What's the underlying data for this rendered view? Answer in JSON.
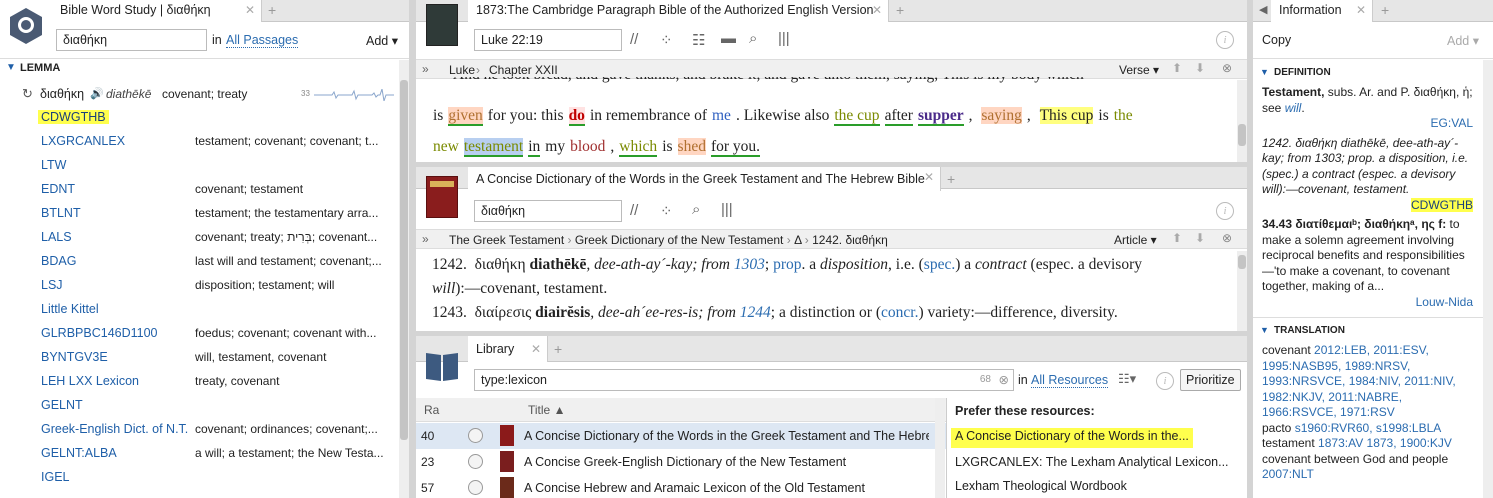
{
  "wordstudy": {
    "tab": "Bible Word Study | διαθήκη",
    "query": "διαθήκη",
    "in_label": "in",
    "passages": "All Passages",
    "add": "Add",
    "section": "LEMMA",
    "lemma_greek": "διαθήκη",
    "lemma_translit": "diathēkē",
    "lemma_gloss": "covenant; treaty",
    "count": "33",
    "rows": [
      {
        "name": "CDWGTHB",
        "gloss": "",
        "hl": true
      },
      {
        "name": "LXGRCANLEX",
        "gloss": "testament; covenant; covenant; t..."
      },
      {
        "name": "LTW",
        "gloss": ""
      },
      {
        "name": "EDNT",
        "gloss": "covenant; testament"
      },
      {
        "name": "BTLNT",
        "gloss": "testament; the testamentary arra..."
      },
      {
        "name": "LALS",
        "gloss": "covenant; treaty; בְּרִית; covenant..."
      },
      {
        "name": "BDAG",
        "gloss": "last will and testament; covenant;..."
      },
      {
        "name": "LSJ",
        "gloss": "disposition; testament; will"
      },
      {
        "name": "Little Kittel",
        "gloss": ""
      },
      {
        "name": "GLRBPBC146D1100",
        "gloss": "foedus; covenant; covenant with..."
      },
      {
        "name": "BYNTGV3E",
        "gloss": "will, testament, covenant"
      },
      {
        "name": "LEH LXX Lexicon",
        "gloss": "treaty, covenant"
      },
      {
        "name": "GELNT",
        "gloss": ""
      },
      {
        "name": "Greek-English Dict. of N.T.",
        "gloss": "covenant; ordinances; covenant;..."
      },
      {
        "name": "GELNT:ALBA",
        "gloss": "a will; a testament; the New Testa..."
      },
      {
        "name": "IGEL",
        "gloss": ""
      }
    ]
  },
  "bible": {
    "tab": "1873:The Cambridge Paragraph Bible of the Authorized English Version",
    "ref": "Luke 22:19",
    "crumb1": "Luke",
    "crumb2": "Chapter XXII",
    "mode": "Verse",
    "line1": "And he took bread, and gave thanks, and brake it, and gave unto them, saying, This is my body which",
    "line2": [
      "is",
      "given",
      "for you: this",
      "do",
      "in remembrance of",
      "me",
      ". Likewise also",
      "the cup",
      "after",
      "supper",
      ", ",
      "saying",
      ", ",
      "This cup",
      "is",
      "the"
    ],
    "line3": [
      "new",
      "testament",
      "in",
      "my",
      "blood",
      ",",
      "which",
      "is",
      "shed",
      "for you."
    ]
  },
  "dict": {
    "tab": "A Concise Dictionary of the Words in the Greek Testament and The Hebrew Bible",
    "query": "διαθήκη",
    "crumbs": [
      "The Greek Testament",
      "Greek Dictionary of the New Testament",
      "Δ",
      "1242. διαθήκη"
    ],
    "mode": "Article",
    "e1_num": "1242.",
    "e1_greek": "διαθήκη",
    "e1_translit": "diathēkē",
    "e1_pron": ", dee-ath-ay´-kay; from",
    "e1_ref": "1303",
    "e1_rest1": "; ",
    "e1_prop": "prop",
    "e1_rest2": ". a ",
    "e1_disp": "disposition",
    "e1_rest3": ", i.e. (",
    "e1_spec": "spec.",
    "e1_rest4": ") a ",
    "e1_contract": "contract",
    "e1_rest5": " (espec. a devisory",
    "e1_line2a": "will",
    "e1_line2b": "):—covenant, testament.",
    "e2_num": "1243.",
    "e2_greek": "διαίρεσις",
    "e2_translit": "diairĕsis",
    "e2_pron": ", dee-ah´ee-res-is; from",
    "e2_ref": "1244",
    "e2_rest": "; a distinction or (",
    "e2_concr": "concr.",
    "e2_rest2": ") variety:—difference, diversity."
  },
  "library": {
    "tab": "Library",
    "query": "type:lexicon",
    "count": "68",
    "in_label": "in",
    "scope": "All Resources",
    "prioritize": "Prioritize",
    "col_rank": "Ra",
    "col_title": "Title",
    "rows": [
      {
        "rank": "40",
        "title": "A Concise Dictionary of the Words in the Greek Testament and The Hebrew B",
        "color": "#8b1a1a"
      },
      {
        "rank": "23",
        "title": "A Concise Greek-English Dictionary of the New Testament",
        "color": "#7a1e1e"
      },
      {
        "rank": "57",
        "title": "A Concise Hebrew and Aramaic Lexicon of the Old Testament",
        "color": "#6b2a1a"
      }
    ],
    "prefer_title": "Prefer these resources:",
    "prefer": [
      "A Concise Dictionary of the Words in the...",
      "LXGRCANLEX: The Lexham Analytical Lexicon...",
      "Lexham Theological Wordbook"
    ]
  },
  "info": {
    "tab": "Information",
    "copy": "Copy",
    "add": "Add",
    "def_title": "DEFINITION",
    "def1_bold": "Testament,",
    "def1_text": " subs. Ar. and P. διαθήκη, ἡ; see ",
    "def1_will": "will",
    "def1_src": "EG:VAL",
    "def2_text": "1242. διαθήκη diathēkē, dee-ath-ay´-kay; from 1303; prop. a disposition, i.e. (spec.) a contract (espec. a devisory will):—covenant, testament.",
    "def2_src": "CDWGTHB",
    "def3_bold": "34.43 διατίθεμαιᵇ; διαθήκηᵃ, ης f:",
    "def3_text": " to make a solemn agreement involving reciprocal benefits and responsibilities—'to make a covenant, to covenant together, making of a...",
    "def3_src": "Louw-Nida",
    "tr_title": "TRANSLATION",
    "tr": [
      {
        "word": "covenant",
        "refs": "2012:LEB, 2011:ESV, 1995:NASB95, 1989:NRSV, 1993:NRSVCE, 1984:NIV, 2011:NIV, 1982:NKJV, 2011:NABRE, 1966:RSVCE, 1971:RSV"
      },
      {
        "word": "pacto",
        "refs": "s1960:RVR60, s1998:LBLA"
      },
      {
        "word": "testament",
        "refs": "1873:AV 1873, 1900:KJV"
      },
      {
        "word": "covenant between God and people",
        "refs": "2007:NLT"
      }
    ]
  },
  "colors": {
    "highlight": "#ffff4d",
    "link": "#2b6cb0"
  }
}
